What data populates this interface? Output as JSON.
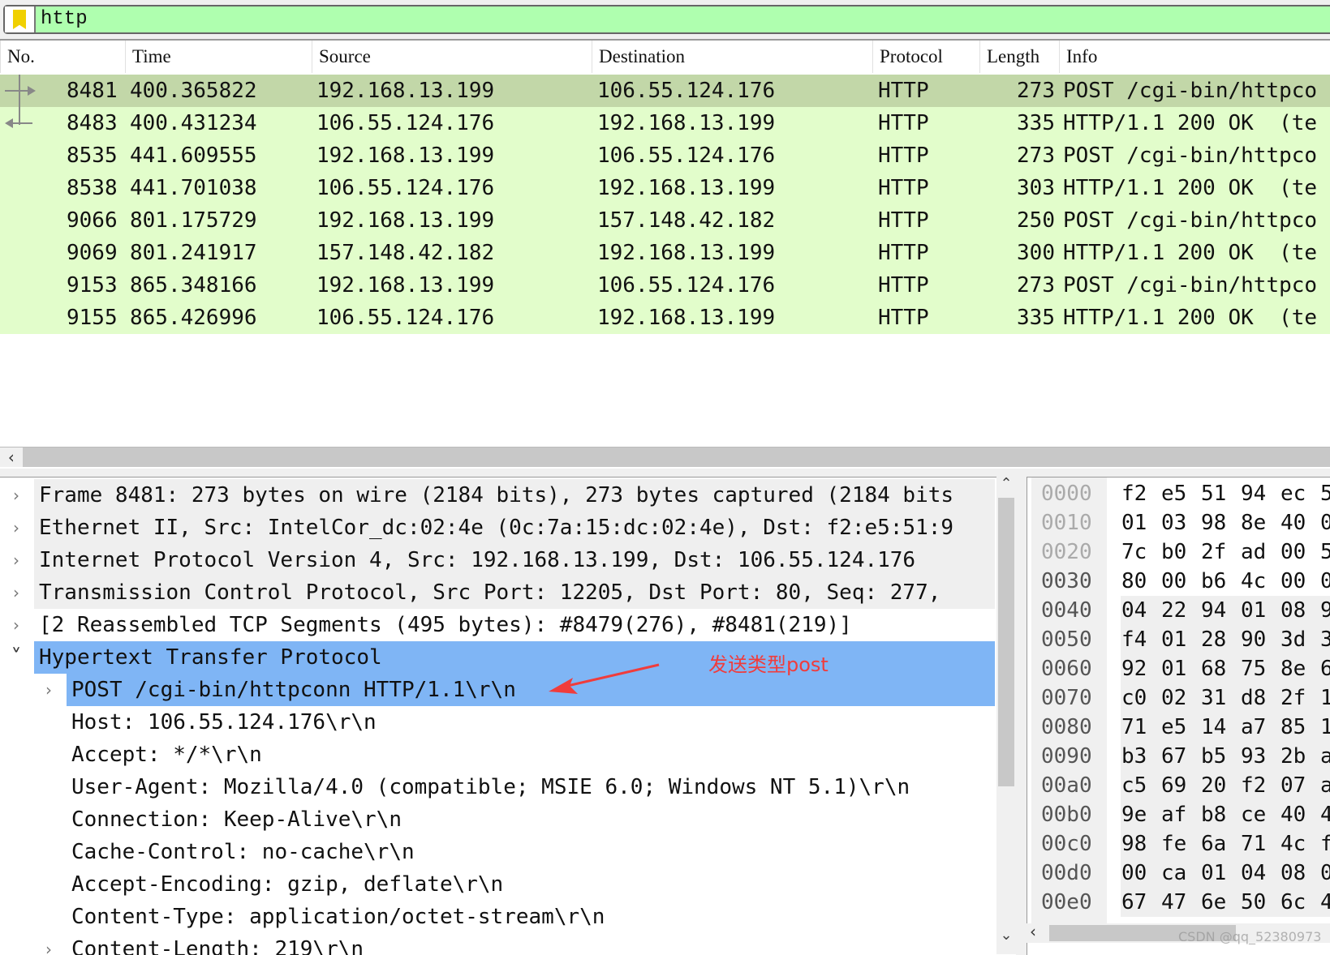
{
  "filter": {
    "value": "http",
    "bg_color": "#afffaf",
    "icon": "bookmark-icon"
  },
  "packet_list": {
    "columns": [
      "No.",
      "Time",
      "Source",
      "Destination",
      "Protocol",
      "Length",
      "Info"
    ],
    "rows": [
      {
        "no": "8481",
        "time": "400.365822",
        "source": "192.168.13.199",
        "destination": "106.55.124.176",
        "protocol": "HTTP",
        "length": "273",
        "info": "POST /cgi-bin/httpco",
        "selected": true,
        "link": "request"
      },
      {
        "no": "8483",
        "time": "400.431234",
        "source": "106.55.124.176",
        "destination": "192.168.13.199",
        "protocol": "HTTP",
        "length": "335",
        "info": "HTTP/1.1 200 OK  (te",
        "link": "response"
      },
      {
        "no": "8535",
        "time": "441.609555",
        "source": "192.168.13.199",
        "destination": "106.55.124.176",
        "protocol": "HTTP",
        "length": "273",
        "info": "POST /cgi-bin/httpco"
      },
      {
        "no": "8538",
        "time": "441.701038",
        "source": "106.55.124.176",
        "destination": "192.168.13.199",
        "protocol": "HTTP",
        "length": "303",
        "info": "HTTP/1.1 200 OK  (te"
      },
      {
        "no": "9066",
        "time": "801.175729",
        "source": "192.168.13.199",
        "destination": "157.148.42.182",
        "protocol": "HTTP",
        "length": "250",
        "info": "POST /cgi-bin/httpco"
      },
      {
        "no": "9069",
        "time": "801.241917",
        "source": "157.148.42.182",
        "destination": "192.168.13.199",
        "protocol": "HTTP",
        "length": "300",
        "info": "HTTP/1.1 200 OK  (te"
      },
      {
        "no": "9153",
        "time": "865.348166",
        "source": "192.168.13.199",
        "destination": "106.55.124.176",
        "protocol": "HTTP",
        "length": "273",
        "info": "POST /cgi-bin/httpco"
      },
      {
        "no": "9155",
        "time": "865.426996",
        "source": "106.55.124.176",
        "destination": "192.168.13.199",
        "protocol": "HTTP",
        "length": "335",
        "info": "HTTP/1.1 200 OK  (te"
      }
    ],
    "row_color": "#e2fdcb",
    "selected_row_color": "#c2d7a8"
  },
  "details": {
    "highlight_color": "#7fb5f5",
    "items": [
      {
        "text": "Frame 8481: 273 bytes on wire (2184 bits), 273 bytes captured (2184 bits",
        "level": 0,
        "expander": "collapsed",
        "shade": "gray"
      },
      {
        "text": "Ethernet II, Src: IntelCor_dc:02:4e (0c:7a:15:dc:02:4e), Dst: f2:e5:51:9",
        "level": 0,
        "expander": "collapsed",
        "shade": "gray"
      },
      {
        "text": "Internet Protocol Version 4, Src: 192.168.13.199, Dst: 106.55.124.176",
        "level": 0,
        "expander": "collapsed",
        "shade": "gray"
      },
      {
        "text": "Transmission Control Protocol, Src Port: 12205, Dst Port: 80, Seq: 277,",
        "level": 0,
        "expander": "collapsed",
        "shade": "gray"
      },
      {
        "text": "[2 Reassembled TCP Segments (495 bytes): #8479(276), #8481(219)]",
        "level": 0,
        "expander": "collapsed",
        "shade": "none"
      },
      {
        "text": "Hypertext Transfer Protocol",
        "level": 0,
        "expander": "expanded",
        "shade": "blue"
      },
      {
        "text": "POST /cgi-bin/httpconn HTTP/1.1\\r\\n",
        "level": 1,
        "expander": "collapsed",
        "shade": "blue"
      },
      {
        "text": "Host: 106.55.124.176\\r\\n",
        "level": 1,
        "expander": "none",
        "shade": "none"
      },
      {
        "text": "Accept: */*\\r\\n",
        "level": 1,
        "expander": "none",
        "shade": "none"
      },
      {
        "text": "User-Agent: Mozilla/4.0 (compatible; MSIE 6.0; Windows NT 5.1)\\r\\n",
        "level": 1,
        "expander": "none",
        "shade": "none"
      },
      {
        "text": "Connection: Keep-Alive\\r\\n",
        "level": 1,
        "expander": "none",
        "shade": "none"
      },
      {
        "text": "Cache-Control: no-cache\\r\\n",
        "level": 1,
        "expander": "none",
        "shade": "none"
      },
      {
        "text": "Accept-Encoding: gzip, deflate\\r\\n",
        "level": 1,
        "expander": "none",
        "shade": "none"
      },
      {
        "text": "Content-Type: application/octet-stream\\r\\n",
        "level": 1,
        "expander": "none",
        "shade": "none"
      },
      {
        "text": "Content-Length: 219\\r\\n",
        "level": 1,
        "expander": "collapsed",
        "shade": "none"
      }
    ]
  },
  "hex": {
    "rows": [
      {
        "offset": "0000",
        "bytes": [
          "f2",
          "e5",
          "51",
          "94",
          "ec",
          "5"
        ]
      },
      {
        "offset": "0010",
        "bytes": [
          "01",
          "03",
          "98",
          "8e",
          "40",
          "0"
        ]
      },
      {
        "offset": "0020",
        "bytes": [
          "7c",
          "b0",
          "2f",
          "ad",
          "00",
          "5"
        ]
      },
      {
        "offset": "0030",
        "bytes": [
          "80",
          "00",
          "b6",
          "4c",
          "00",
          "0"
        ]
      },
      {
        "offset": "0040",
        "bytes": [
          "04",
          "22",
          "94",
          "01",
          "08",
          "9"
        ]
      },
      {
        "offset": "0050",
        "bytes": [
          "f4",
          "01",
          "28",
          "90",
          "3d",
          "3"
        ]
      },
      {
        "offset": "0060",
        "bytes": [
          "92",
          "01",
          "68",
          "75",
          "8e",
          "6"
        ]
      },
      {
        "offset": "0070",
        "bytes": [
          "c0",
          "02",
          "31",
          "d8",
          "2f",
          "1"
        ]
      },
      {
        "offset": "0080",
        "bytes": [
          "71",
          "e5",
          "14",
          "a7",
          "85",
          "1"
        ]
      },
      {
        "offset": "0090",
        "bytes": [
          "b3",
          "67",
          "b5",
          "93",
          "2b",
          "a"
        ]
      },
      {
        "offset": "00a0",
        "bytes": [
          "c5",
          "69",
          "20",
          "f2",
          "07",
          "a"
        ]
      },
      {
        "offset": "00b0",
        "bytes": [
          "9e",
          "af",
          "b8",
          "ce",
          "40",
          "4"
        ]
      },
      {
        "offset": "00c0",
        "bytes": [
          "98",
          "fe",
          "6a",
          "71",
          "4c",
          "f"
        ]
      },
      {
        "offset": "00d0",
        "bytes": [
          "00",
          "ca",
          "01",
          "04",
          "08",
          "0"
        ]
      },
      {
        "offset": "00e0",
        "bytes": [
          "67",
          "47",
          "6e",
          "50",
          "6c",
          "4"
        ]
      }
    ],
    "highlight_from_row": 4
  },
  "annotation": {
    "text": "发送类型post",
    "color": "#f03c3c"
  },
  "watermark": "CSDN @qq_52380973"
}
